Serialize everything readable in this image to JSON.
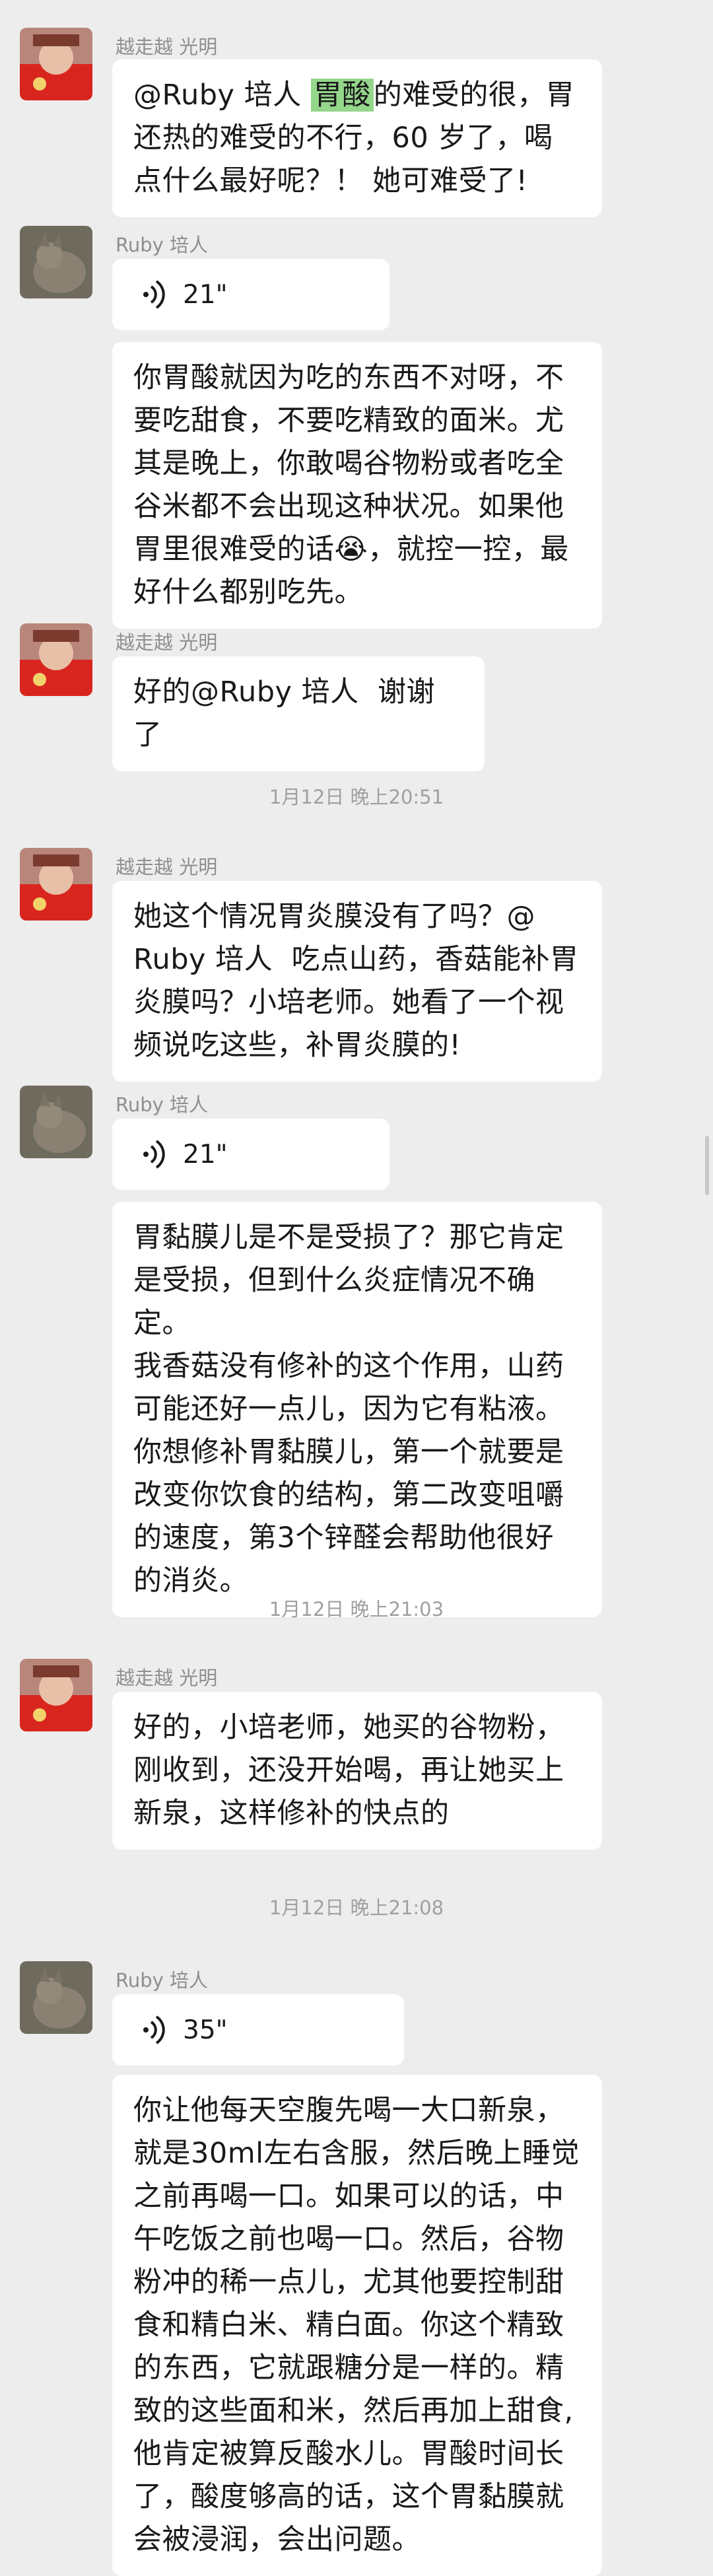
{
  "senders": {
    "yue": "越走越 光明",
    "ruby": "Ruby 培人"
  },
  "messages": {
    "m1": {
      "before": "@Ruby 培人 ",
      "highlight": "胃酸",
      "after": "的难受的很，胃\n还热的难受的不行，60 岁了，喝\n点什么最好呢？！ 她可难受了!"
    },
    "m2": {
      "duration": "21\""
    },
    "m3": {
      "text": "你胃酸就因为吃的东西不对呀，不\n要吃甜食，不要吃精致的面米。尤\n其是晚上，你敢喝谷物粉或者吃全\n谷米都不会出现这种状况。如果他\n胃里很难受的话😭，就控一控，最\n好什么都别吃先。"
    },
    "m4": {
      "text": "好的@Ruby 培人  谢谢了"
    },
    "t1": "1月12日 晚上20:51",
    "m5": {
      "text": "她这个情况胃炎膜没有了吗？@\nRuby 培人  吃点山药，香菇能补胃\n炎膜吗？小培老师。她看了一个视\n频说吃这些，补胃炎膜的!"
    },
    "m6": {
      "duration": "21\""
    },
    "m7": {
      "text": "胃黏膜儿是不是受损了？那它肯定\n是受损，但到什么炎症情况不确定。\n我香菇没有修补的这个作用，山药\n可能还好一点儿，因为它有粘液。\n你想修补胃黏膜儿，第一个就要是\n改变你饮食的结构，第二改变咀嚼\n的速度，第3个锌醛会帮助他很好\n的消炎。"
    },
    "t2": "1月12日 晚上21:03",
    "m8": {
      "text": "好的，小培老师，她买的谷物粉，\n刚收到，还没开始喝，再让她买上\n新泉，这样修补的快点的"
    },
    "t3": "1月12日 晚上21:08",
    "m9": {
      "duration": "35\""
    },
    "m10": {
      "text": "你让他每天空腹先喝一大口新泉，\n就是30ml左右含服，然后晚上睡觉\n之前再喝一口。如果可以的话，中\n午吃饭之前也喝一口。然后，谷物\n粉冲的稀一点儿，尤其他要控制甜\n食和精白米、精白面。你这个精致\n的东西，它就跟糖分是一样的。精\n致的这些面和米，然后再加上甜食,\n他肯定被算反酸水儿。胃酸时间长\n了，酸度够高的话，这个胃黏膜就\n会被浸润，会出问题。"
    }
  },
  "colors": {
    "background": "#ededed",
    "bubble": "#ffffff",
    "highlight": "#94d68a",
    "meta_text": "#8f8f8f"
  },
  "icons": {
    "voice": "voice-wave-icon",
    "avatar_yue": "child-red-outfit-avatar",
    "avatar_ruby": "cat-avatar"
  }
}
